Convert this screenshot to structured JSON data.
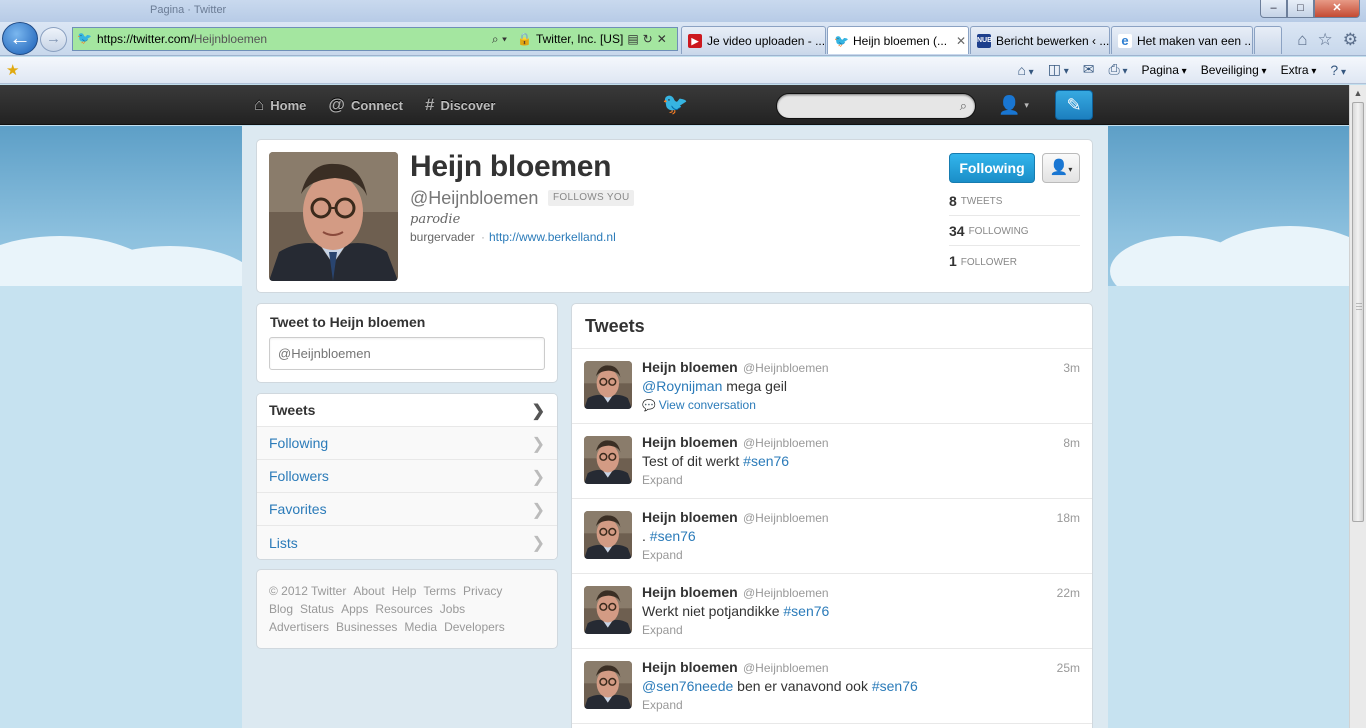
{
  "browser": {
    "window_title": "Pagina · Twitter",
    "window_buttons": [
      "–",
      "□",
      "✕"
    ],
    "address": {
      "host": "https://twitter.com/",
      "path": "Heijnbloemen",
      "certificate": "Twitter, Inc. [US]"
    },
    "tabs": [
      {
        "label": "Je video uploaden - ...",
        "favicon": "youtube-icon",
        "color": "#cc181e",
        "active": false
      },
      {
        "label": "Heijn bloemen (...",
        "favicon": "twitter-bird-icon",
        "color": "#2a9fd6",
        "active": true
      },
      {
        "label": "Bericht bewerken ‹ ...",
        "favicon": "nub-icon",
        "color": "#1d3f8c",
        "active": false
      },
      {
        "label": "Het maken van een ...",
        "favicon": "ie-icon",
        "color": "#2f7fd1",
        "active": false
      }
    ],
    "command_bar": {
      "pagina": "Pagina",
      "beveiliging": "Beveiliging",
      "extra": "Extra"
    }
  },
  "twitter_nav": {
    "home": "Home",
    "connect": "Connect",
    "discover": "Discover",
    "search_placeholder": ""
  },
  "profile": {
    "name": "Heijn bloemen",
    "handle": "@Heijnbloemen",
    "follows_you": "FOLLOWS YOU",
    "bio": "parodie",
    "location": "burgervader",
    "url": "http://www.berkelland.nl",
    "follow_button": "Following",
    "stats": [
      {
        "count": "8",
        "label": "TWEETS"
      },
      {
        "count": "34",
        "label": "FOLLOWING"
      },
      {
        "count": "1",
        "label": "FOLLOWER"
      }
    ]
  },
  "tweet_box": {
    "title": "Tweet to Heijn bloemen",
    "placeholder": "@Heijnbloemen"
  },
  "side_menu": [
    {
      "label": "Tweets",
      "active": true
    },
    {
      "label": "Following",
      "active": false
    },
    {
      "label": "Followers",
      "active": false
    },
    {
      "label": "Favorites",
      "active": false
    },
    {
      "label": "Lists",
      "active": false
    }
  ],
  "footer": {
    "line1": [
      "© 2012 Twitter",
      "About",
      "Help",
      "Terms",
      "Privacy"
    ],
    "line2": [
      "Blog",
      "Status",
      "Apps",
      "Resources",
      "Jobs"
    ],
    "line3": [
      "Advertisers",
      "Businesses",
      "Media",
      "Developers"
    ]
  },
  "timeline": {
    "title": "Tweets",
    "tweets": [
      {
        "name": "Heijn bloemen",
        "handle": "@Heijnbloemen",
        "time": "3m",
        "mention": "@Roynijman",
        "text": " mega geil",
        "hashtag": "",
        "action": "View conversation"
      },
      {
        "name": "Heijn bloemen",
        "handle": "@Heijnbloemen",
        "time": "8m",
        "mention": "",
        "text": "Test of dit werkt ",
        "hashtag": "#sen76",
        "action": "Expand"
      },
      {
        "name": "Heijn bloemen",
        "handle": "@Heijnbloemen",
        "time": "18m",
        "mention": "",
        "text": ". ",
        "hashtag": "#sen76",
        "action": "Expand"
      },
      {
        "name": "Heijn bloemen",
        "handle": "@Heijnbloemen",
        "time": "22m",
        "mention": "",
        "text": "Werkt niet potjandikke ",
        "hashtag": "#sen76",
        "action": "Expand"
      },
      {
        "name": "Heijn bloemen",
        "handle": "@Heijnbloemen",
        "time": "25m",
        "mention": "@sen76neede",
        "text": " ben er vanavond ook ",
        "hashtag": "#sen76",
        "action": "Expand"
      }
    ]
  },
  "colors": {
    "twitter_blue": "#2b7bb9",
    "follow_button": "#1a8ec8",
    "topbar": "#222222"
  }
}
